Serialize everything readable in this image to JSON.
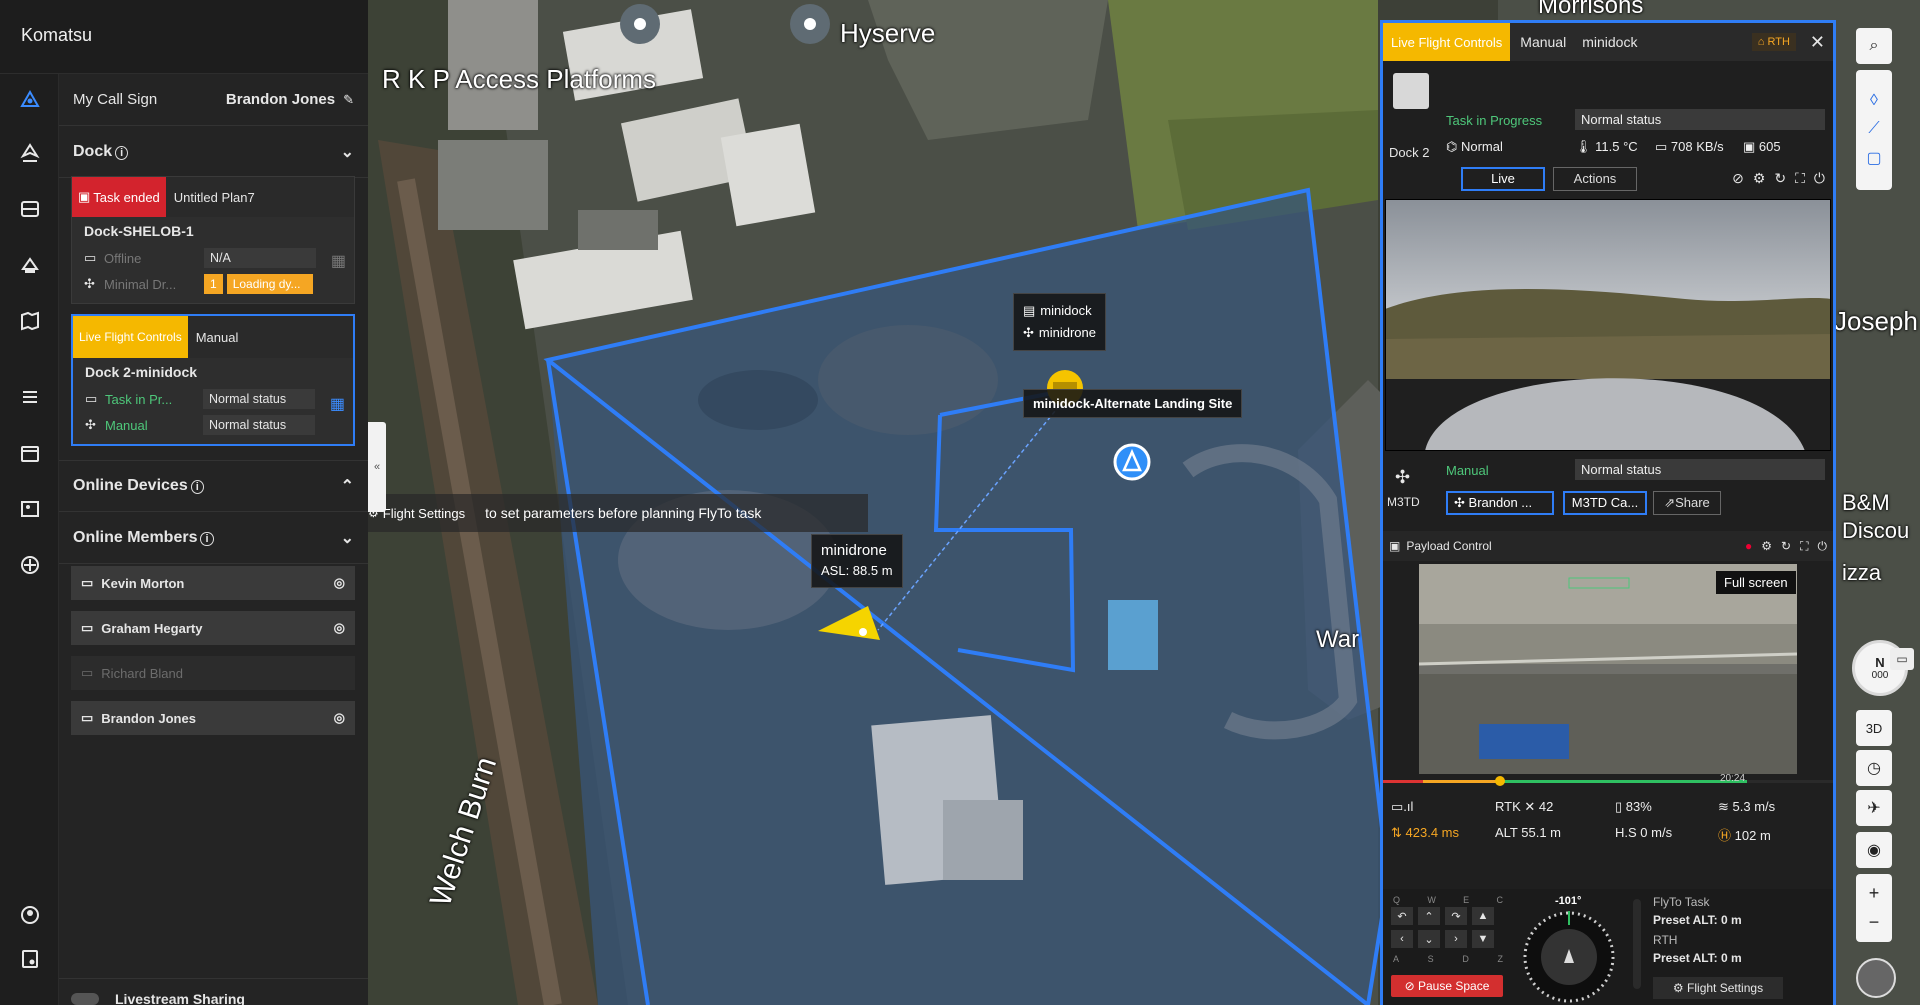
{
  "app": {
    "title": "Komatsu"
  },
  "callsign": {
    "label": "My Call Sign",
    "name": "Brandon Jones"
  },
  "dock_section": {
    "title": "Dock"
  },
  "card1": {
    "status": "Task ended",
    "plan": "Untitled Plan7",
    "dock": "Dock-SHELOB-1",
    "row1_label": "Offline",
    "row1_value": "N/A",
    "row2_label": "Minimal Dr...",
    "row2_count": "1",
    "row2_value": "Loading dy..."
  },
  "card2": {
    "tab_live": "Live Flight Controls",
    "tab_manual": "Manual",
    "dock": "Dock 2-minidock",
    "row1_label": "Task in Pr...",
    "row1_value": "Normal status",
    "row2_label": "Manual",
    "row2_value": "Normal status"
  },
  "online_devices": {
    "title": "Online Devices"
  },
  "online_members": {
    "title": "Online Members",
    "members": [
      "Kevin Morton",
      "Graham Hegarty",
      "Richard Bland",
      "Brandon Jones"
    ]
  },
  "livestream": {
    "label": "Livestream Sharing"
  },
  "map": {
    "labels": [
      "R K P Access Platforms",
      "Hyserve",
      "War",
      "Welch Burn",
      "Morrisons",
      "Joseph",
      "B&M",
      "Discou",
      "izza"
    ],
    "tip_dock": "minidock",
    "tip_drone": "minidrone",
    "tip_landing": "minidock-Alternate Landing Site",
    "tip_drone_name": "minidrone",
    "tip_drone_asl": "ASL: 88.5 m",
    "hint_settings": "Flight Settings",
    "hint_text": "to set parameters before planning FlyTo task"
  },
  "rp": {
    "tab_live": "Live Flight Controls",
    "tab_manual": "Manual",
    "tab_device": "minidock",
    "rth": "RTH",
    "dock_name": "Dock 2",
    "task_status": "Task in Progress",
    "dock_status": "Normal status",
    "mode": "Normal",
    "temp": "11.5 °C",
    "net": "708 KB/s",
    "storage": "605",
    "btn_live": "Live",
    "btn_actions": "Actions",
    "drone_mode": "Manual",
    "drone_status": "Normal status",
    "drone_model": "M3TD",
    "pilot_btn": "Brandon ...",
    "camera_btn": "M3TD Ca...",
    "share_btn": "Share",
    "payload": "Payload Control",
    "fullscreen_tip": "Full screen",
    "timeline_end": "20:24",
    "rtk": "RTK",
    "rtk_val": "42",
    "battery": "83%",
    "speed": "5.3 m/s",
    "latency": "423.4 ms",
    "alt": "ALT 55.1 m",
    "hs": "H.S 0 m/s",
    "home_dist": "102 m",
    "keys": [
      "Q",
      "W",
      "E",
      "C",
      "A",
      "S",
      "D",
      "Z"
    ],
    "heading": "-101°",
    "flyto_title": "FlyTo Task",
    "flyto_alt": "Preset ALT: 0 m",
    "rth_title": "RTH",
    "rth_alt": "Preset ALT: 0 m",
    "pause_btn": "Pause Space",
    "flight_settings_btn": "Flight Settings"
  },
  "tools": {
    "view3d": "3D",
    "compass": "N",
    "compass_val": "000"
  }
}
